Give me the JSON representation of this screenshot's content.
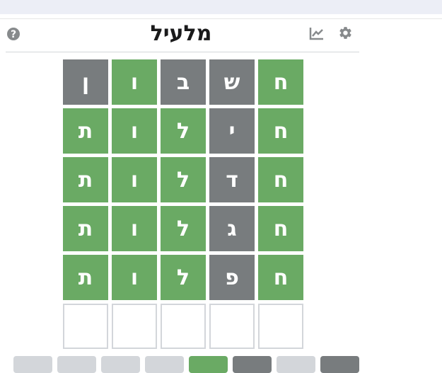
{
  "header": {
    "title": "מלעיל",
    "icons": [
      "help-icon",
      "stats-icon",
      "settings-icon"
    ]
  },
  "colors": {
    "correct": "#6aaa64",
    "absent": "#787c7e",
    "empty_border": "#d3d6da",
    "unused_key": "#d3d6da"
  },
  "board": {
    "rows": [
      [
        {
          "letter": "ח",
          "state": "correct"
        },
        {
          "letter": "ש",
          "state": "absent"
        },
        {
          "letter": "ב",
          "state": "absent"
        },
        {
          "letter": "ו",
          "state": "correct"
        },
        {
          "letter": "ן",
          "state": "absent"
        }
      ],
      [
        {
          "letter": "ח",
          "state": "correct"
        },
        {
          "letter": "י",
          "state": "absent"
        },
        {
          "letter": "ל",
          "state": "correct"
        },
        {
          "letter": "ו",
          "state": "correct"
        },
        {
          "letter": "ת",
          "state": "correct"
        }
      ],
      [
        {
          "letter": "ח",
          "state": "correct"
        },
        {
          "letter": "ד",
          "state": "absent"
        },
        {
          "letter": "ל",
          "state": "correct"
        },
        {
          "letter": "ו",
          "state": "correct"
        },
        {
          "letter": "ת",
          "state": "correct"
        }
      ],
      [
        {
          "letter": "ח",
          "state": "correct"
        },
        {
          "letter": "ג",
          "state": "absent"
        },
        {
          "letter": "ל",
          "state": "correct"
        },
        {
          "letter": "ו",
          "state": "correct"
        },
        {
          "letter": "ת",
          "state": "correct"
        }
      ],
      [
        {
          "letter": "ח",
          "state": "correct"
        },
        {
          "letter": "פ",
          "state": "absent"
        },
        {
          "letter": "ל",
          "state": "correct"
        },
        {
          "letter": "ו",
          "state": "correct"
        },
        {
          "letter": "ת",
          "state": "correct"
        }
      ],
      [
        {
          "letter": "",
          "state": "empty"
        },
        {
          "letter": "",
          "state": "empty"
        },
        {
          "letter": "",
          "state": "empty"
        },
        {
          "letter": "",
          "state": "empty"
        },
        {
          "letter": "",
          "state": "empty"
        }
      ]
    ]
  },
  "keyboard": {
    "top_row_states": [
      "absent",
      "unused",
      "absent",
      "correct",
      "unused",
      "unused",
      "unused",
      "unused"
    ]
  }
}
